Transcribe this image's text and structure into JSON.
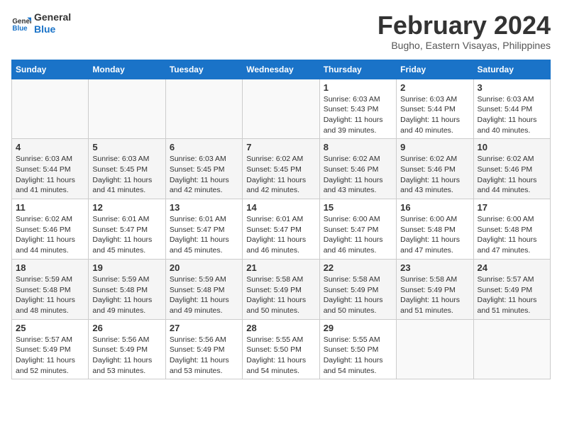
{
  "logo": {
    "line1": "General",
    "line2": "Blue"
  },
  "title": "February 2024",
  "subtitle": "Bugho, Eastern Visayas, Philippines",
  "days_of_week": [
    "Sunday",
    "Monday",
    "Tuesday",
    "Wednesday",
    "Thursday",
    "Friday",
    "Saturday"
  ],
  "weeks": [
    [
      {
        "day": "",
        "info": ""
      },
      {
        "day": "",
        "info": ""
      },
      {
        "day": "",
        "info": ""
      },
      {
        "day": "",
        "info": ""
      },
      {
        "day": "1",
        "info": "Sunrise: 6:03 AM\nSunset: 5:43 PM\nDaylight: 11 hours and 39 minutes."
      },
      {
        "day": "2",
        "info": "Sunrise: 6:03 AM\nSunset: 5:44 PM\nDaylight: 11 hours and 40 minutes."
      },
      {
        "day": "3",
        "info": "Sunrise: 6:03 AM\nSunset: 5:44 PM\nDaylight: 11 hours and 40 minutes."
      }
    ],
    [
      {
        "day": "4",
        "info": "Sunrise: 6:03 AM\nSunset: 5:44 PM\nDaylight: 11 hours and 41 minutes."
      },
      {
        "day": "5",
        "info": "Sunrise: 6:03 AM\nSunset: 5:45 PM\nDaylight: 11 hours and 41 minutes."
      },
      {
        "day": "6",
        "info": "Sunrise: 6:03 AM\nSunset: 5:45 PM\nDaylight: 11 hours and 42 minutes."
      },
      {
        "day": "7",
        "info": "Sunrise: 6:02 AM\nSunset: 5:45 PM\nDaylight: 11 hours and 42 minutes."
      },
      {
        "day": "8",
        "info": "Sunrise: 6:02 AM\nSunset: 5:46 PM\nDaylight: 11 hours and 43 minutes."
      },
      {
        "day": "9",
        "info": "Sunrise: 6:02 AM\nSunset: 5:46 PM\nDaylight: 11 hours and 43 minutes."
      },
      {
        "day": "10",
        "info": "Sunrise: 6:02 AM\nSunset: 5:46 PM\nDaylight: 11 hours and 44 minutes."
      }
    ],
    [
      {
        "day": "11",
        "info": "Sunrise: 6:02 AM\nSunset: 5:46 PM\nDaylight: 11 hours and 44 minutes."
      },
      {
        "day": "12",
        "info": "Sunrise: 6:01 AM\nSunset: 5:47 PM\nDaylight: 11 hours and 45 minutes."
      },
      {
        "day": "13",
        "info": "Sunrise: 6:01 AM\nSunset: 5:47 PM\nDaylight: 11 hours and 45 minutes."
      },
      {
        "day": "14",
        "info": "Sunrise: 6:01 AM\nSunset: 5:47 PM\nDaylight: 11 hours and 46 minutes."
      },
      {
        "day": "15",
        "info": "Sunrise: 6:00 AM\nSunset: 5:47 PM\nDaylight: 11 hours and 46 minutes."
      },
      {
        "day": "16",
        "info": "Sunrise: 6:00 AM\nSunset: 5:48 PM\nDaylight: 11 hours and 47 minutes."
      },
      {
        "day": "17",
        "info": "Sunrise: 6:00 AM\nSunset: 5:48 PM\nDaylight: 11 hours and 47 minutes."
      }
    ],
    [
      {
        "day": "18",
        "info": "Sunrise: 5:59 AM\nSunset: 5:48 PM\nDaylight: 11 hours and 48 minutes."
      },
      {
        "day": "19",
        "info": "Sunrise: 5:59 AM\nSunset: 5:48 PM\nDaylight: 11 hours and 49 minutes."
      },
      {
        "day": "20",
        "info": "Sunrise: 5:59 AM\nSunset: 5:48 PM\nDaylight: 11 hours and 49 minutes."
      },
      {
        "day": "21",
        "info": "Sunrise: 5:58 AM\nSunset: 5:49 PM\nDaylight: 11 hours and 50 minutes."
      },
      {
        "day": "22",
        "info": "Sunrise: 5:58 AM\nSunset: 5:49 PM\nDaylight: 11 hours and 50 minutes."
      },
      {
        "day": "23",
        "info": "Sunrise: 5:58 AM\nSunset: 5:49 PM\nDaylight: 11 hours and 51 minutes."
      },
      {
        "day": "24",
        "info": "Sunrise: 5:57 AM\nSunset: 5:49 PM\nDaylight: 11 hours and 51 minutes."
      }
    ],
    [
      {
        "day": "25",
        "info": "Sunrise: 5:57 AM\nSunset: 5:49 PM\nDaylight: 11 hours and 52 minutes."
      },
      {
        "day": "26",
        "info": "Sunrise: 5:56 AM\nSunset: 5:49 PM\nDaylight: 11 hours and 53 minutes."
      },
      {
        "day": "27",
        "info": "Sunrise: 5:56 AM\nSunset: 5:49 PM\nDaylight: 11 hours and 53 minutes."
      },
      {
        "day": "28",
        "info": "Sunrise: 5:55 AM\nSunset: 5:50 PM\nDaylight: 11 hours and 54 minutes."
      },
      {
        "day": "29",
        "info": "Sunrise: 5:55 AM\nSunset: 5:50 PM\nDaylight: 11 hours and 54 minutes."
      },
      {
        "day": "",
        "info": ""
      },
      {
        "day": "",
        "info": ""
      }
    ]
  ]
}
